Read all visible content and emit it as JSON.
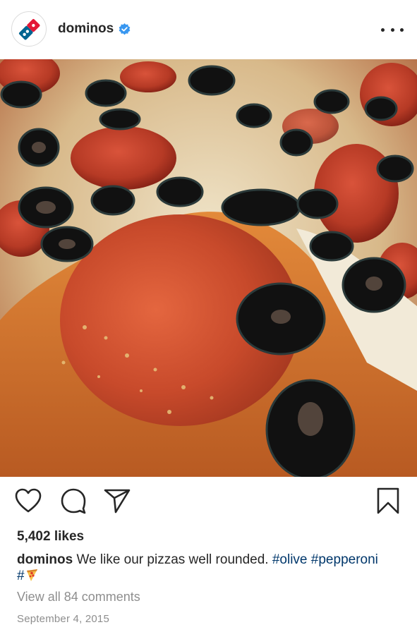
{
  "post": {
    "username": "dominos",
    "verified": true,
    "more_icon": "more-horizontal-icon",
    "image_icon": "pizza-photo",
    "actions": {
      "like": "heart-icon",
      "comment": "comment-icon",
      "share": "send-icon",
      "save": "bookmark-icon"
    },
    "likes": "5,402 likes",
    "caption": {
      "user": "dominos",
      "text": "We like our pizzas well rounded.",
      "tag1": "#olive",
      "tag2": "#pepperoni",
      "tag3": "#",
      "tag3_emoji": "pizza-emoji"
    },
    "comments_link": "View all 84 comments",
    "date": "September 4, 2015"
  },
  "colors": {
    "brand_blue": "#006491",
    "brand_red": "#e31837",
    "verified_blue": "#3897f0",
    "hashtag": "#00376b",
    "muted": "#8e8e8e"
  }
}
